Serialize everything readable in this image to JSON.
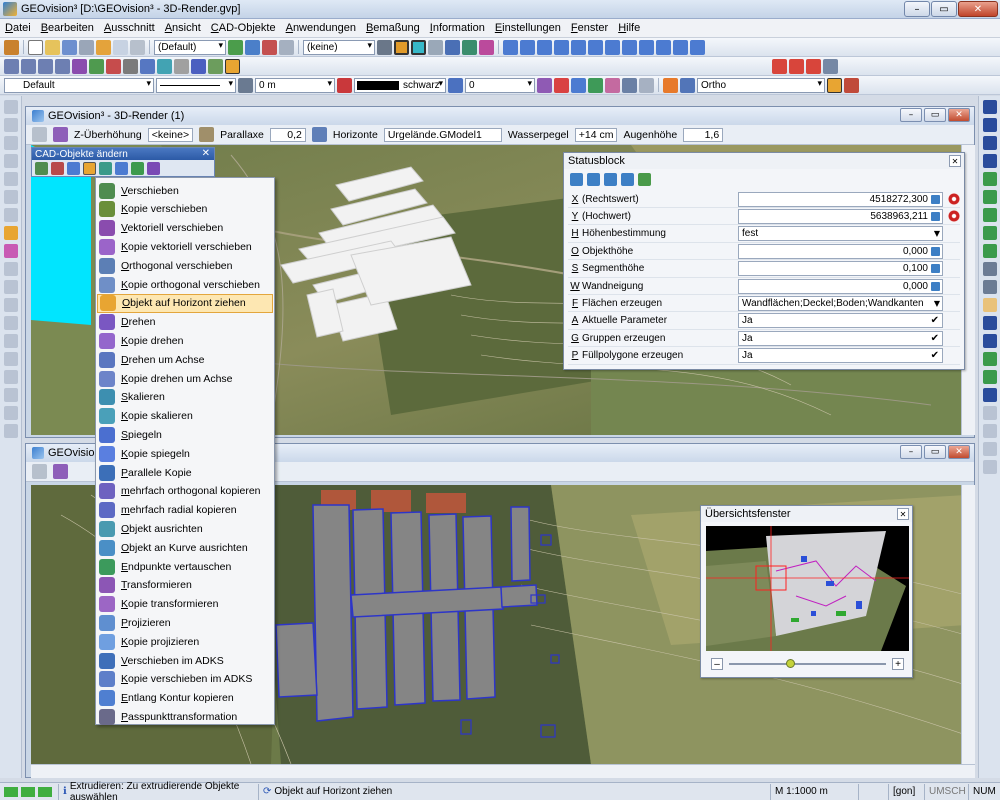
{
  "window": {
    "title": "GEOvision³  [D:\\GEOvision³ - 3D-Render.gvp]",
    "btn_min": "–",
    "btn_max": "▭",
    "btn_close": "✕"
  },
  "menubar": [
    "Datei",
    "Bearbeiten",
    "Ausschnitt",
    "Ansicht",
    "CAD-Objekte",
    "Anwendungen",
    "Bemaßung",
    "Information",
    "Einstellungen",
    "Fenster",
    "Hilfe"
  ],
  "toolbar1": {
    "layer_combo": "(Default)",
    "filter_combo": "(keine)"
  },
  "toolbar3": {
    "style_combo": "Default",
    "width_value": "0 m",
    "color_name": "schwarz",
    "offset_value": "0",
    "mode_combo": "Ortho"
  },
  "window1": {
    "title": "GEOvision³ - 3D-Render (1)",
    "params": {
      "z_label": "Z-Überhöhung",
      "z_value": "<keine>",
      "parallax_label": "Parallaxe",
      "parallax_value": "0,2",
      "horizon_label": "Horizonte",
      "horizon_value": "Urgelände.GModel1",
      "water_label": "Wasserpegel",
      "water_value": "+14 cm",
      "eye_label": "Augenhöhe",
      "eye_value": "1,6"
    }
  },
  "window2": {
    "title": "GEOvision³ - 3D-Render (2)"
  },
  "cad_panel": {
    "title": "CAD-Objekte ändern",
    "close": "✕"
  },
  "context_menu": [
    "Verschieben",
    "Kopie verschieben",
    "Vektoriell verschieben",
    "Kopie vektoriell verschieben",
    "Orthogonal verschieben",
    "Kopie orthogonal verschieben",
    "Objekt auf Horizont ziehen",
    "Drehen",
    "Kopie drehen",
    "Drehen um Achse",
    "Kopie drehen um Achse",
    "Skalieren",
    "Kopie skalieren",
    "Spiegeln",
    "Kopie spiegeln",
    "Parallele Kopie",
    "mehrfach orthogonal kopieren",
    "mehrfach radial kopieren",
    "Objekt ausrichten",
    "Objekt an Kurve ausrichten",
    "Endpunkte vertauschen",
    "Transformieren",
    "Kopie transformieren",
    "Projizieren",
    "Kopie projizieren",
    "Verschieben im ADKS",
    "Kopie verschieben im ADKS",
    "Entlang Kontur kopieren",
    "Passpunkttransformation"
  ],
  "context_menu_selected": 6,
  "statusblock": {
    "title": "Statusblock",
    "rows": [
      {
        "key": "X",
        "label": "(Rechtswert)",
        "value": "4518272,300",
        "type": "num"
      },
      {
        "key": "Y",
        "label": "(Hochwert)",
        "value": "5638963,211",
        "type": "num"
      },
      {
        "key": "H",
        "label": "Höhenbestimmung",
        "value": "fest",
        "type": "drop"
      },
      {
        "key": "O",
        "label": "Objekthöhe",
        "value": "0,000",
        "type": "num"
      },
      {
        "key": "S",
        "label": "Segmenthöhe",
        "value": "0,100",
        "type": "num"
      },
      {
        "key": "W",
        "label": "Wandneigung",
        "value": "0,000",
        "type": "num"
      },
      {
        "key": "F",
        "label": "Flächen erzeugen",
        "value": "Wandflächen;Deckel;Boden;Wandkanten",
        "type": "drop"
      },
      {
        "key": "A",
        "label": "Aktuelle Parameter",
        "value": "Ja",
        "type": "chk"
      },
      {
        "key": "G",
        "label": "Gruppen erzeugen",
        "value": "Ja",
        "type": "chk"
      },
      {
        "key": "P",
        "label": "Füllpolygone erzeugen",
        "value": "Ja",
        "type": "chk"
      }
    ]
  },
  "overview": {
    "title": "Übersichtsfenster",
    "minus": "–",
    "plus": "+"
  },
  "statusbar": {
    "hint": "Extrudieren: Zu extrudierende Objekte auswählen",
    "command": "Objekt auf Horizont ziehen",
    "scale": "M 1:1000  m",
    "unit": "[gon]",
    "umsch": "UMSCH",
    "num": "NUM"
  },
  "colors": {
    "accent": "#2c5aa6",
    "cyan_area": "#00e5ff",
    "building": "#8a8a8a",
    "building_edge": "#2d35c9"
  }
}
